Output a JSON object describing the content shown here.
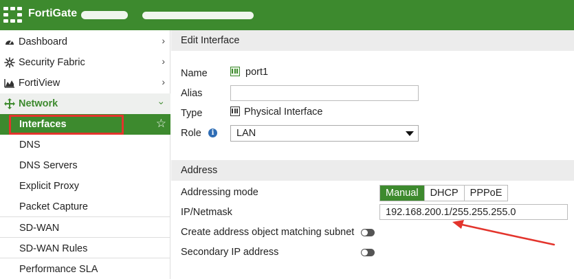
{
  "header": {
    "brand": "FortiGate"
  },
  "sidebar": {
    "items": [
      {
        "label": "Dashboard",
        "icon": "dashboard-icon"
      },
      {
        "label": "Security Fabric",
        "icon": "security-fabric-icon"
      },
      {
        "label": "FortiView",
        "icon": "chart-icon"
      },
      {
        "label": "Network",
        "icon": "network-move-icon"
      },
      {
        "label": "Interfaces"
      },
      {
        "label": "DNS"
      },
      {
        "label": "DNS Servers"
      },
      {
        "label": "Explicit Proxy"
      },
      {
        "label": "Packet Capture"
      },
      {
        "label": "SD-WAN"
      },
      {
        "label": "SD-WAN Rules"
      },
      {
        "label": "Performance SLA"
      }
    ]
  },
  "main": {
    "title": "Edit Interface",
    "name_label": "Name",
    "name_value": "port1",
    "alias_label": "Alias",
    "alias_value": "",
    "type_label": "Type",
    "type_value": "Physical Interface",
    "role_label": "Role",
    "role_value": "LAN",
    "address_header": "Address",
    "addressing_mode_label": "Addressing mode",
    "addressing_modes": [
      "Manual",
      "DHCP",
      "PPPoE"
    ],
    "addressing_mode_selected": "Manual",
    "ip_label": "IP/Netmask",
    "ip_value": "192.168.200.1/255.255.255.0",
    "create_object_label": "Create address object matching subnet",
    "secondary_ip_label": "Secondary IP address"
  },
  "colors": {
    "brand_green": "#3d8a2e",
    "highlight_red": "#e3342c"
  }
}
